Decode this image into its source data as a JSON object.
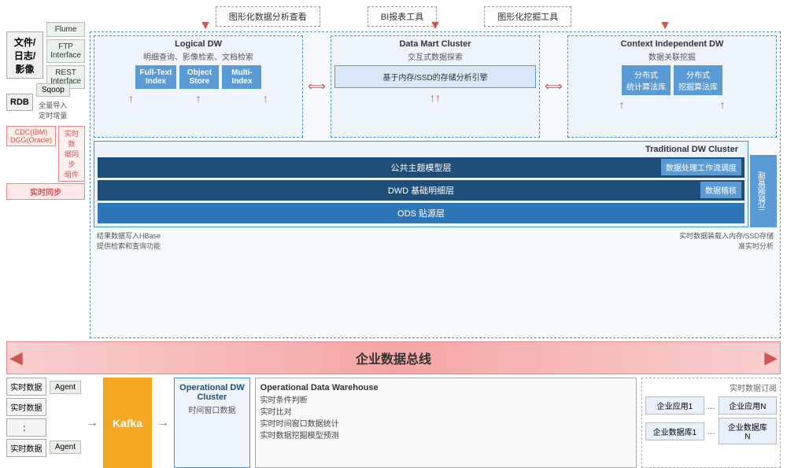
{
  "topTools": {
    "items": [
      "图形化数据分析查看",
      "BI报表工具",
      "图形化挖掘工具"
    ]
  },
  "leftSide": {
    "fileSource": "文件/\n日志/\n影像",
    "flume": "Flume",
    "ftpInterface": "FTP\nInterface",
    "restInterface": "REST\nInterface",
    "rdb": "RDB",
    "sqoop": "Sqoop",
    "fullImport": "全量导入\n定时增量",
    "cdc": "CDC(IBM)\nDGG(Oracle)",
    "realtimeSync": "实时同步",
    "syncComponent": "实时数\n据同步\n组件"
  },
  "logicalDW": {
    "title": "Logical DW",
    "subtitle": "明细查询、影像检索、文档检索",
    "fullTextIndex": "Full-Text\nIndex",
    "objectStore": "Object\nStore",
    "multiIndex": "Multi-\nIndex"
  },
  "dataMart": {
    "title": "Data Mart Cluster",
    "subtitle": "交互式数据探索",
    "ssdLabel": "基于内存/SSD的存储分析引擎"
  },
  "contextDW": {
    "title": "Context Independent DW",
    "subtitle": "数据关联挖掘",
    "dist1": "分布式\n统计算法库",
    "dist2": "分布式\n挖掘算法库"
  },
  "traditionalDW": {
    "title": "Traditional DW Cluster",
    "layer1": "公共主题模型层",
    "layer2": "DWD 基础明细层",
    "layer3": "ODS 贴源层",
    "badge1": "数据处理工作流调度",
    "badge2": "数据稽核",
    "metaLabel": "元\n数\n据\n管\n理"
  },
  "enterpriseBus": {
    "label": "企业数据总线"
  },
  "notes": {
    "leftNote1": "结果数据写入HBase",
    "leftNote2": "提供检索和查询功能",
    "rightNote1": "实时数据装载入内存/SSD存储",
    "rightNote2": "准实时分析"
  },
  "bottomLeft": {
    "items": [
      "实时数据",
      "实时数据",
      "：",
      "实时数据"
    ],
    "agents": [
      "Agent",
      "Agent"
    ]
  },
  "kafka": {
    "label": "Kafka"
  },
  "opDW": {
    "title": "Operational DW\nCluster",
    "subtitle": "时间窗口数据"
  },
  "opDWInfo": {
    "title": "Operational Data Warehouse",
    "items": [
      "实时条件判断",
      "实时比对",
      "实时时间窗口数据统计",
      "实时数据挖掘模型预测"
    ]
  },
  "bottomRight": {
    "title": "实时数据订阅",
    "row1": [
      "企业应用1",
      "...",
      "企业应用N"
    ],
    "row2": [
      "企业数据库1",
      "...",
      "企业数据库N"
    ]
  }
}
